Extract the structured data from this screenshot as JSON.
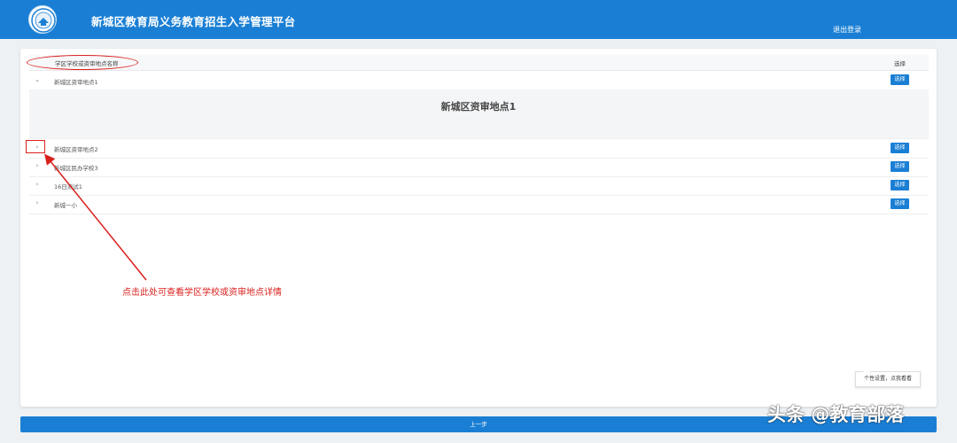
{
  "header": {
    "title": "新城区教育局义务教育招生入学管理平台",
    "logout": "退出登录"
  },
  "table": {
    "column_name": "学区学校或资审地点名称",
    "column_select": "选择",
    "rows": [
      {
        "label": "新城区资审地点1",
        "arrow": "⌄",
        "select": "选择"
      },
      {
        "label": "新城区资审地点2",
        "arrow": "›",
        "select": "选择"
      },
      {
        "label": "新城区民办学校3",
        "arrow": "›",
        "select": "选择"
      },
      {
        "label": "16日测试1",
        "arrow": "›",
        "select": "选择"
      },
      {
        "label": "新城一小",
        "arrow": "›",
        "select": "选择"
      }
    ],
    "expanded_detail_title": "新城区资审地点1"
  },
  "annotation": {
    "text": "点击此处可查看学区学校或资审地点详情"
  },
  "tooltip": "个性设置，点我看看",
  "footer": {
    "prev_button": "上一步"
  },
  "watermark": "头条 @教育部落",
  "colors": {
    "primary": "#1a7fd4",
    "annotation_red": "#d9201d"
  }
}
